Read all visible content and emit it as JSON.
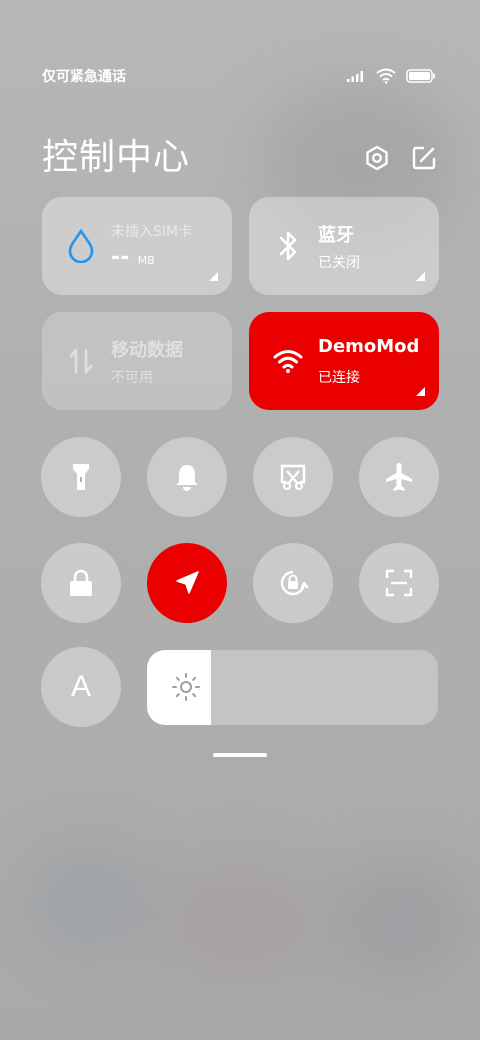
{
  "status_bar": {
    "carrier": "仅可紧急通话"
  },
  "header": {
    "title": "控制中心"
  },
  "tiles": {
    "data_usage": {
      "title": "未插入SIM卡",
      "value": "--",
      "unit": "MB"
    },
    "bluetooth": {
      "title": "蓝牙",
      "status": "已关闭"
    },
    "mobile_data": {
      "title": "移动数据",
      "status": "不可用"
    },
    "wifi": {
      "title": "DemoMod",
      "status": "已连接"
    }
  },
  "toggles": [
    "flashlight-icon",
    "bell-icon",
    "screenshot-icon",
    "airplane-icon",
    "lock-icon",
    "location-icon",
    "rotation-lock-icon",
    "scan-icon",
    "font-icon"
  ],
  "font_label": "A",
  "brightness": {
    "level": 0.22
  },
  "colors": {
    "accent": "#ea0000",
    "data_icon": "#2196f3"
  }
}
